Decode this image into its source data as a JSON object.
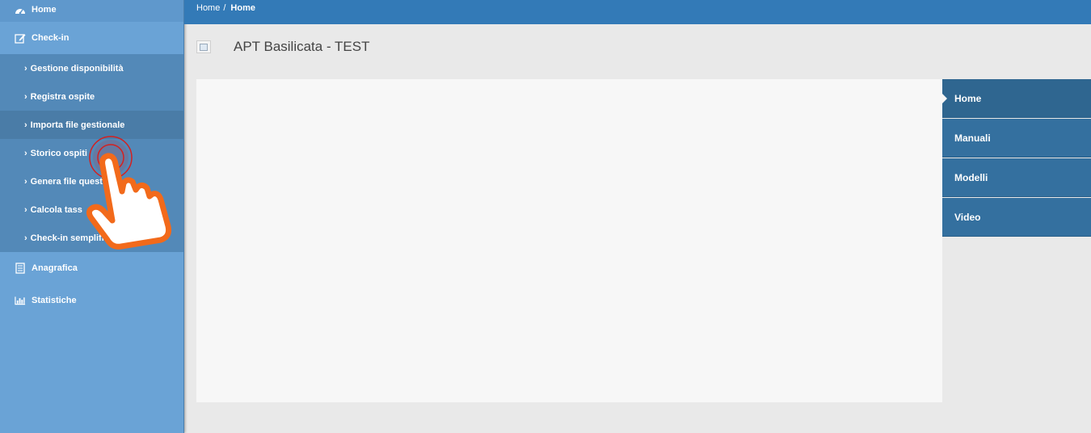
{
  "sidebar": {
    "home": {
      "label": "Home",
      "icon": "dashboard-icon"
    },
    "checkin": {
      "label": "Check-in",
      "icon": "edit-icon"
    },
    "checkin_items": [
      {
        "label": "Gestione disponibilità"
      },
      {
        "label": "Registra ospite"
      },
      {
        "label": "Importa file gestionale"
      },
      {
        "label": "Storico ospiti"
      },
      {
        "label": "Genera file questu"
      },
      {
        "label": "Calcola tass"
      },
      {
        "label": "Check-in semplifica"
      }
    ],
    "anagrafica": {
      "label": "Anagrafica",
      "icon": "document-icon"
    },
    "statistiche": {
      "label": "Statistiche",
      "icon": "bar-chart-icon"
    }
  },
  "breadcrumb": {
    "home": "Home",
    "separator": "/",
    "current": "Home"
  },
  "header": {
    "title": "APT Basilicata - TEST"
  },
  "right_menu": [
    {
      "label": "Home"
    },
    {
      "label": "Manuali"
    },
    {
      "label": "Modelli"
    },
    {
      "label": "Video"
    }
  ],
  "colors": {
    "topbar": "#337ab7",
    "sidebar": "#6aa3d6",
    "submenu": "#5389b8",
    "right_menu": "#34709f",
    "pointer_accent": "#f26a1b"
  }
}
